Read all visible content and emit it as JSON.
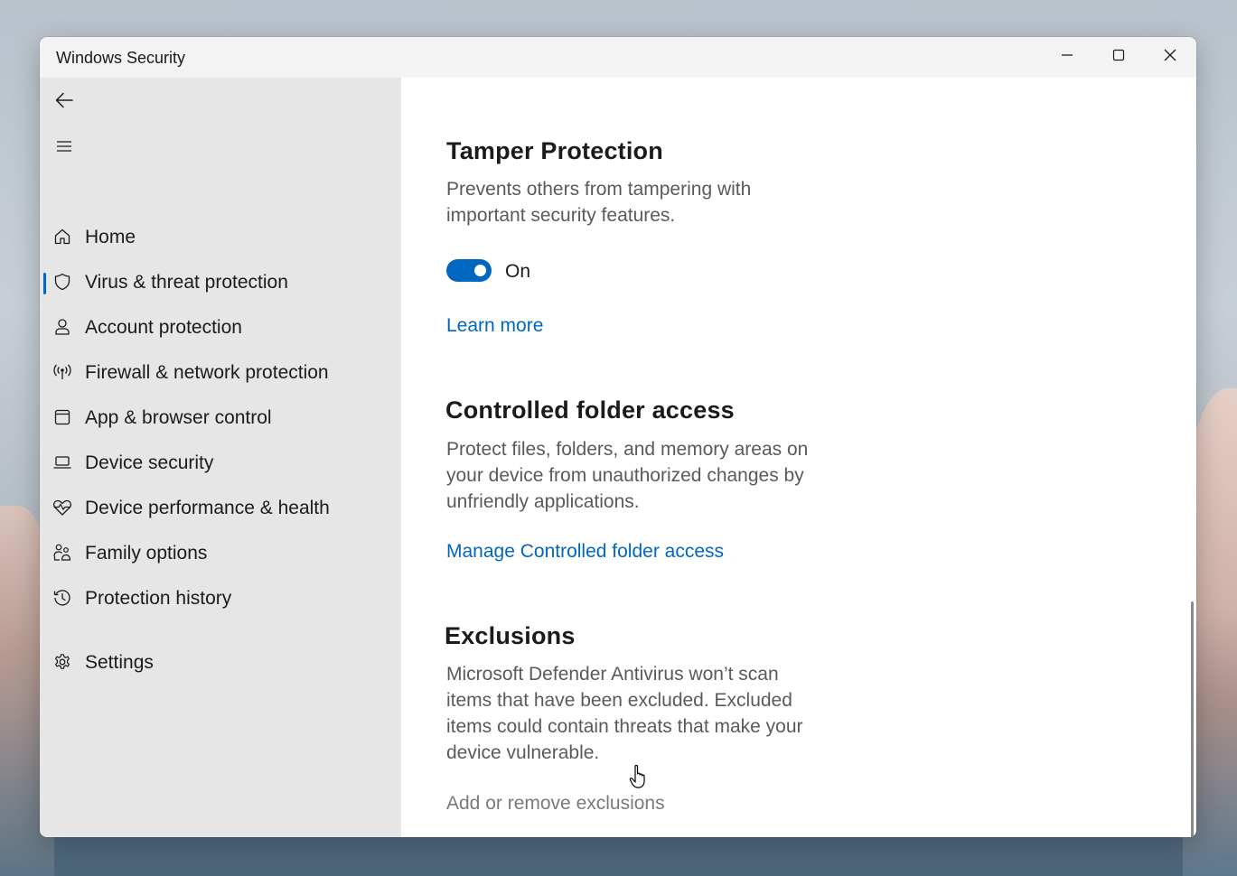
{
  "window": {
    "title": "Windows Security",
    "minimize_icon": "minimize-icon",
    "maximize_icon": "maximize-icon",
    "close_icon": "close-icon"
  },
  "sidebar": {
    "back_icon": "back-arrow-icon",
    "menu_icon": "hamburger-menu-icon",
    "items": [
      {
        "label": "Home",
        "icon": "home-icon",
        "selected": false
      },
      {
        "label": "Virus & threat protection",
        "icon": "shield-icon",
        "selected": true
      },
      {
        "label": "Account protection",
        "icon": "person-icon",
        "selected": false
      },
      {
        "label": "Firewall & network protection",
        "icon": "antenna-icon",
        "selected": false
      },
      {
        "label": "App & browser control",
        "icon": "app-window-icon",
        "selected": false
      },
      {
        "label": "Device security",
        "icon": "laptop-icon",
        "selected": false
      },
      {
        "label": "Device performance & health",
        "icon": "heart-pulse-icon",
        "selected": false
      },
      {
        "label": "Family options",
        "icon": "family-icon",
        "selected": false
      },
      {
        "label": "Protection history",
        "icon": "history-icon",
        "selected": false
      }
    ],
    "settings": {
      "label": "Settings",
      "icon": "gear-icon"
    }
  },
  "main": {
    "tamper": {
      "title": "Tamper Protection",
      "description": "Prevents others from tampering with important security features.",
      "toggle_state": "On",
      "toggle_on": true,
      "learn_more": "Learn more"
    },
    "controlled_folder": {
      "title": "Controlled folder access",
      "description": "Protect files, folders, and memory areas on your device from unauthorized changes by unfriendly applications.",
      "link": "Manage Controlled folder access"
    },
    "exclusions": {
      "title": "Exclusions",
      "description": "Microsoft Defender Antivirus won’t scan items that have been excluded. Excluded items could contain threats that make your device vulnerable.",
      "link": "Add or remove exclusions"
    }
  },
  "colors": {
    "accent": "#0067c0",
    "sidebar_bg": "#e6e6e6",
    "content_bg": "#ffffff"
  }
}
